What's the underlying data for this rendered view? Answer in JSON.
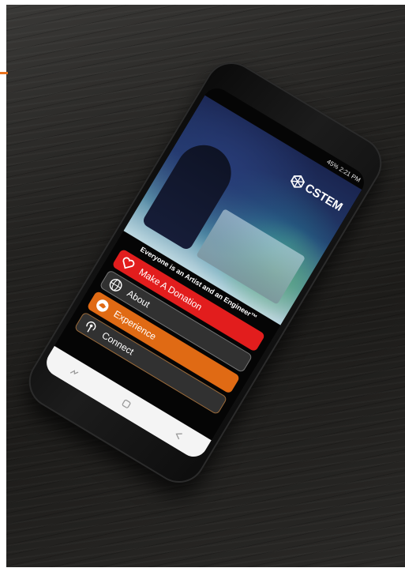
{
  "status": {
    "battery": "45%",
    "time": "2:21 PM"
  },
  "app": {
    "logo_text": "CSTEM",
    "tagline": "Everyone is an Artist and an Engineer™"
  },
  "menu": {
    "items": [
      {
        "label": "Make A Donation",
        "icon": "heart-icon",
        "color": "#e21d1d"
      },
      {
        "label": "About",
        "icon": "globe-icon",
        "color": "#3c3c3c"
      },
      {
        "label": "Experience",
        "icon": "hand-icon",
        "color": "#e06a14"
      },
      {
        "label": "Connect",
        "icon": "broadcast-icon",
        "color": "#3c3c3c"
      }
    ]
  },
  "navbar": {
    "buttons": [
      "recents-icon",
      "home-icon",
      "back-icon"
    ]
  }
}
